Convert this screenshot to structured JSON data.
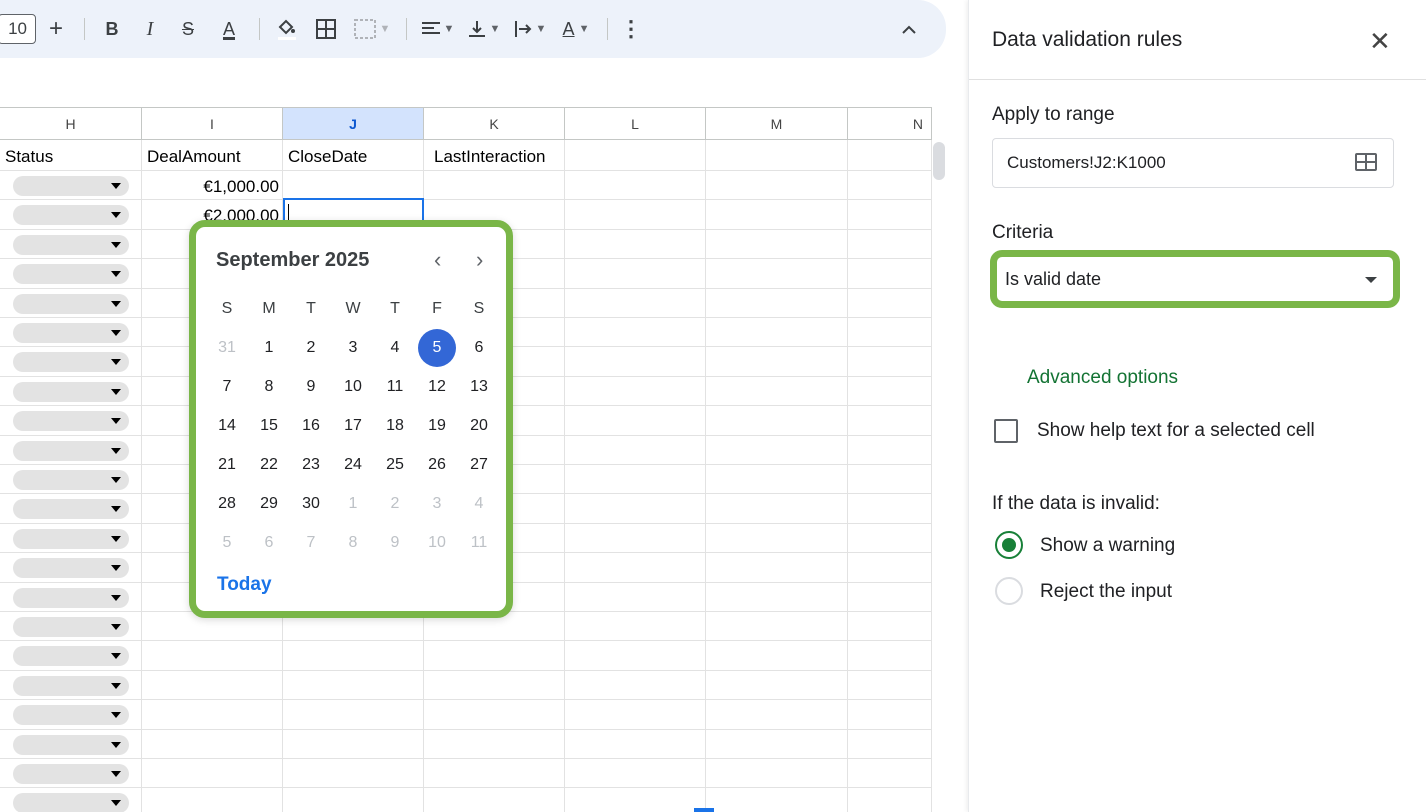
{
  "colors": {
    "toolbar_bg": "#edf2fa",
    "highlight_outline": "#7ab648",
    "selected_day": "#3367d6",
    "link_blue": "#1a73e8",
    "advanced_green": "#137333"
  },
  "toolbar": {
    "font_size": "10",
    "plus": "+",
    "bold": "B",
    "italic": "I",
    "strikethrough": "S",
    "text_color": "A",
    "fill_color_icon": "paint-bucket-icon",
    "borders_icon": "borders-icon",
    "merge_icon": "merge-cells-icon",
    "align_icon": "align-left-icon",
    "valign_icon": "valign-bottom-icon",
    "wrap_icon": "text-wrap-icon",
    "rotate_icon": "text-rotate-icon",
    "more_icon": "more-vert-icon",
    "collapse_icon": "chevron-up-icon"
  },
  "sheet": {
    "columns": [
      {
        "label": "H",
        "selected": false
      },
      {
        "label": "I",
        "selected": false
      },
      {
        "label": "J",
        "selected": true
      },
      {
        "label": "K",
        "selected": false
      },
      {
        "label": "L",
        "selected": false
      },
      {
        "label": "M",
        "selected": false
      },
      {
        "label": "N",
        "selected": false
      }
    ],
    "headers": {
      "h": "Status",
      "i": "DealAmount",
      "j": "CloseDate",
      "k": "LastInteraction"
    },
    "row1_amount": "€1,000.00",
    "row2_amount": "€2,000.00"
  },
  "calendar": {
    "month_title": "September 2025",
    "prev": "‹",
    "next": "›",
    "weekdays": [
      "S",
      "M",
      "T",
      "W",
      "T",
      "F",
      "S"
    ],
    "weeks": [
      [
        "31",
        "1",
        "2",
        "3",
        "4",
        "5",
        "6"
      ],
      [
        "7",
        "8",
        "9",
        "10",
        "11",
        "12",
        "13"
      ],
      [
        "14",
        "15",
        "16",
        "17",
        "18",
        "19",
        "20"
      ],
      [
        "21",
        "22",
        "23",
        "24",
        "25",
        "26",
        "27"
      ],
      [
        "28",
        "29",
        "30",
        "1",
        "2",
        "3",
        "4"
      ],
      [
        "5",
        "6",
        "7",
        "8",
        "9",
        "10",
        "11"
      ]
    ],
    "selected_day": "5",
    "today_label": "Today"
  },
  "panel": {
    "title": "Data validation rules",
    "close_icon": "close-icon",
    "apply_label": "Apply to range",
    "range_value": "Customers!J2:K1000",
    "criteria_label": "Criteria",
    "criteria_value": "Is valid date",
    "advanced_label": "Advanced options",
    "help_text_label": "Show help text for a selected cell",
    "invalid_label": "If the data is invalid:",
    "warning_label": "Show a warning",
    "reject_label": "Reject the input"
  }
}
